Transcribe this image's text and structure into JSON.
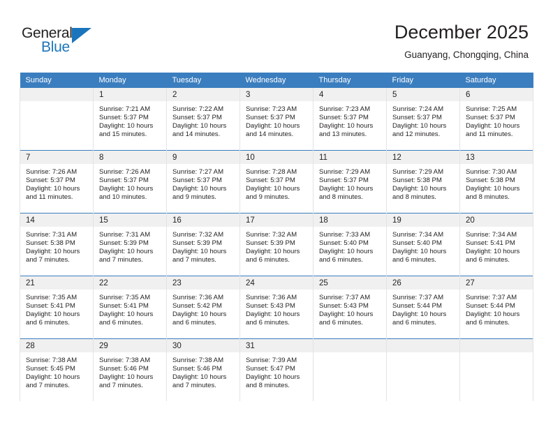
{
  "brand": {
    "name_part1": "General",
    "name_part2": "Blue"
  },
  "header": {
    "title": "December 2025",
    "subtitle": "Guanyang, Chongqing, China"
  },
  "colors": {
    "header_blue": "#3b7ebf",
    "logo_blue": "#1b75bc",
    "daynum_band": "#f0f0f0",
    "text": "#231f20"
  },
  "weekdays": [
    "Sunday",
    "Monday",
    "Tuesday",
    "Wednesday",
    "Thursday",
    "Friday",
    "Saturday"
  ],
  "weeks": [
    [
      {
        "day": "",
        "sunrise": "",
        "sunset": "",
        "daylight_line1": "",
        "daylight_line2": ""
      },
      {
        "day": "1",
        "sunrise": "Sunrise: 7:21 AM",
        "sunset": "Sunset: 5:37 PM",
        "daylight_line1": "Daylight: 10 hours",
        "daylight_line2": "and 15 minutes."
      },
      {
        "day": "2",
        "sunrise": "Sunrise: 7:22 AM",
        "sunset": "Sunset: 5:37 PM",
        "daylight_line1": "Daylight: 10 hours",
        "daylight_line2": "and 14 minutes."
      },
      {
        "day": "3",
        "sunrise": "Sunrise: 7:23 AM",
        "sunset": "Sunset: 5:37 PM",
        "daylight_line1": "Daylight: 10 hours",
        "daylight_line2": "and 14 minutes."
      },
      {
        "day": "4",
        "sunrise": "Sunrise: 7:23 AM",
        "sunset": "Sunset: 5:37 PM",
        "daylight_line1": "Daylight: 10 hours",
        "daylight_line2": "and 13 minutes."
      },
      {
        "day": "5",
        "sunrise": "Sunrise: 7:24 AM",
        "sunset": "Sunset: 5:37 PM",
        "daylight_line1": "Daylight: 10 hours",
        "daylight_line2": "and 12 minutes."
      },
      {
        "day": "6",
        "sunrise": "Sunrise: 7:25 AM",
        "sunset": "Sunset: 5:37 PM",
        "daylight_line1": "Daylight: 10 hours",
        "daylight_line2": "and 11 minutes."
      }
    ],
    [
      {
        "day": "7",
        "sunrise": "Sunrise: 7:26 AM",
        "sunset": "Sunset: 5:37 PM",
        "daylight_line1": "Daylight: 10 hours",
        "daylight_line2": "and 11 minutes."
      },
      {
        "day": "8",
        "sunrise": "Sunrise: 7:26 AM",
        "sunset": "Sunset: 5:37 PM",
        "daylight_line1": "Daylight: 10 hours",
        "daylight_line2": "and 10 minutes."
      },
      {
        "day": "9",
        "sunrise": "Sunrise: 7:27 AM",
        "sunset": "Sunset: 5:37 PM",
        "daylight_line1": "Daylight: 10 hours",
        "daylight_line2": "and 9 minutes."
      },
      {
        "day": "10",
        "sunrise": "Sunrise: 7:28 AM",
        "sunset": "Sunset: 5:37 PM",
        "daylight_line1": "Daylight: 10 hours",
        "daylight_line2": "and 9 minutes."
      },
      {
        "day": "11",
        "sunrise": "Sunrise: 7:29 AM",
        "sunset": "Sunset: 5:37 PM",
        "daylight_line1": "Daylight: 10 hours",
        "daylight_line2": "and 8 minutes."
      },
      {
        "day": "12",
        "sunrise": "Sunrise: 7:29 AM",
        "sunset": "Sunset: 5:38 PM",
        "daylight_line1": "Daylight: 10 hours",
        "daylight_line2": "and 8 minutes."
      },
      {
        "day": "13",
        "sunrise": "Sunrise: 7:30 AM",
        "sunset": "Sunset: 5:38 PM",
        "daylight_line1": "Daylight: 10 hours",
        "daylight_line2": "and 8 minutes."
      }
    ],
    [
      {
        "day": "14",
        "sunrise": "Sunrise: 7:31 AM",
        "sunset": "Sunset: 5:38 PM",
        "daylight_line1": "Daylight: 10 hours",
        "daylight_line2": "and 7 minutes."
      },
      {
        "day": "15",
        "sunrise": "Sunrise: 7:31 AM",
        "sunset": "Sunset: 5:39 PM",
        "daylight_line1": "Daylight: 10 hours",
        "daylight_line2": "and 7 minutes."
      },
      {
        "day": "16",
        "sunrise": "Sunrise: 7:32 AM",
        "sunset": "Sunset: 5:39 PM",
        "daylight_line1": "Daylight: 10 hours",
        "daylight_line2": "and 7 minutes."
      },
      {
        "day": "17",
        "sunrise": "Sunrise: 7:32 AM",
        "sunset": "Sunset: 5:39 PM",
        "daylight_line1": "Daylight: 10 hours",
        "daylight_line2": "and 6 minutes."
      },
      {
        "day": "18",
        "sunrise": "Sunrise: 7:33 AM",
        "sunset": "Sunset: 5:40 PM",
        "daylight_line1": "Daylight: 10 hours",
        "daylight_line2": "and 6 minutes."
      },
      {
        "day": "19",
        "sunrise": "Sunrise: 7:34 AM",
        "sunset": "Sunset: 5:40 PM",
        "daylight_line1": "Daylight: 10 hours",
        "daylight_line2": "and 6 minutes."
      },
      {
        "day": "20",
        "sunrise": "Sunrise: 7:34 AM",
        "sunset": "Sunset: 5:41 PM",
        "daylight_line1": "Daylight: 10 hours",
        "daylight_line2": "and 6 minutes."
      }
    ],
    [
      {
        "day": "21",
        "sunrise": "Sunrise: 7:35 AM",
        "sunset": "Sunset: 5:41 PM",
        "daylight_line1": "Daylight: 10 hours",
        "daylight_line2": "and 6 minutes."
      },
      {
        "day": "22",
        "sunrise": "Sunrise: 7:35 AM",
        "sunset": "Sunset: 5:41 PM",
        "daylight_line1": "Daylight: 10 hours",
        "daylight_line2": "and 6 minutes."
      },
      {
        "day": "23",
        "sunrise": "Sunrise: 7:36 AM",
        "sunset": "Sunset: 5:42 PM",
        "daylight_line1": "Daylight: 10 hours",
        "daylight_line2": "and 6 minutes."
      },
      {
        "day": "24",
        "sunrise": "Sunrise: 7:36 AM",
        "sunset": "Sunset: 5:43 PM",
        "daylight_line1": "Daylight: 10 hours",
        "daylight_line2": "and 6 minutes."
      },
      {
        "day": "25",
        "sunrise": "Sunrise: 7:37 AM",
        "sunset": "Sunset: 5:43 PM",
        "daylight_line1": "Daylight: 10 hours",
        "daylight_line2": "and 6 minutes."
      },
      {
        "day": "26",
        "sunrise": "Sunrise: 7:37 AM",
        "sunset": "Sunset: 5:44 PM",
        "daylight_line1": "Daylight: 10 hours",
        "daylight_line2": "and 6 minutes."
      },
      {
        "day": "27",
        "sunrise": "Sunrise: 7:37 AM",
        "sunset": "Sunset: 5:44 PM",
        "daylight_line1": "Daylight: 10 hours",
        "daylight_line2": "and 6 minutes."
      }
    ],
    [
      {
        "day": "28",
        "sunrise": "Sunrise: 7:38 AM",
        "sunset": "Sunset: 5:45 PM",
        "daylight_line1": "Daylight: 10 hours",
        "daylight_line2": "and 7 minutes."
      },
      {
        "day": "29",
        "sunrise": "Sunrise: 7:38 AM",
        "sunset": "Sunset: 5:46 PM",
        "daylight_line1": "Daylight: 10 hours",
        "daylight_line2": "and 7 minutes."
      },
      {
        "day": "30",
        "sunrise": "Sunrise: 7:38 AM",
        "sunset": "Sunset: 5:46 PM",
        "daylight_line1": "Daylight: 10 hours",
        "daylight_line2": "and 7 minutes."
      },
      {
        "day": "31",
        "sunrise": "Sunrise: 7:39 AM",
        "sunset": "Sunset: 5:47 PM",
        "daylight_line1": "Daylight: 10 hours",
        "daylight_line2": "and 8 minutes."
      },
      {
        "day": "",
        "sunrise": "",
        "sunset": "",
        "daylight_line1": "",
        "daylight_line2": ""
      },
      {
        "day": "",
        "sunrise": "",
        "sunset": "",
        "daylight_line1": "",
        "daylight_line2": ""
      },
      {
        "day": "",
        "sunrise": "",
        "sunset": "",
        "daylight_line1": "",
        "daylight_line2": ""
      }
    ]
  ]
}
